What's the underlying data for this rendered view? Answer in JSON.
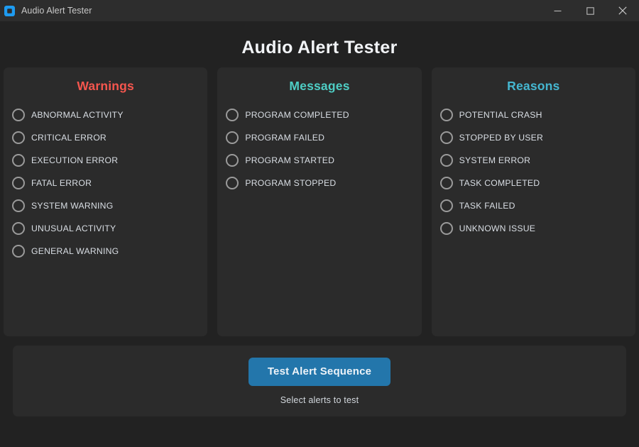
{
  "window": {
    "title": "Audio Alert Tester",
    "icon": "app-logo-icon",
    "accent_blue": "#1e9bf0",
    "titlebar_bg": "#2d2d2d",
    "body_bg": "#222222",
    "panel_bg": "#2b2b2b",
    "controls": {
      "minimize": "minimize-icon",
      "maximize": "maximize-icon",
      "close": "close-icon"
    }
  },
  "header": {
    "title": "Audio Alert Tester"
  },
  "columns": [
    {
      "title": "Warnings",
      "color": "#f5564e",
      "options": [
        {
          "label": "ABNORMAL ACTIVITY",
          "selected": false
        },
        {
          "label": "CRITICAL ERROR",
          "selected": false
        },
        {
          "label": "EXECUTION ERROR",
          "selected": false
        },
        {
          "label": "FATAL ERROR",
          "selected": false
        },
        {
          "label": "SYSTEM WARNING",
          "selected": false
        },
        {
          "label": "UNUSUAL ACTIVITY",
          "selected": false
        },
        {
          "label": "GENERAL WARNING",
          "selected": false
        }
      ]
    },
    {
      "title": "Messages",
      "color": "#4ecdc4",
      "options": [
        {
          "label": "PROGRAM COMPLETED",
          "selected": false
        },
        {
          "label": "PROGRAM FAILED",
          "selected": false
        },
        {
          "label": "PROGRAM STARTED",
          "selected": false
        },
        {
          "label": "PROGRAM STOPPED",
          "selected": false
        }
      ]
    },
    {
      "title": "Reasons",
      "color": "#45b7d1",
      "options": [
        {
          "label": "POTENTIAL CRASH",
          "selected": false
        },
        {
          "label": "STOPPED BY USER",
          "selected": false
        },
        {
          "label": "SYSTEM ERROR",
          "selected": false
        },
        {
          "label": "TASK COMPLETED",
          "selected": false
        },
        {
          "label": "TASK FAILED",
          "selected": false
        },
        {
          "label": "UNKNOWN ISSUE",
          "selected": false
        }
      ]
    }
  ],
  "footer": {
    "button_label": "Test Alert Sequence",
    "button_color": "#2376ab",
    "status": "Select alerts to test"
  }
}
